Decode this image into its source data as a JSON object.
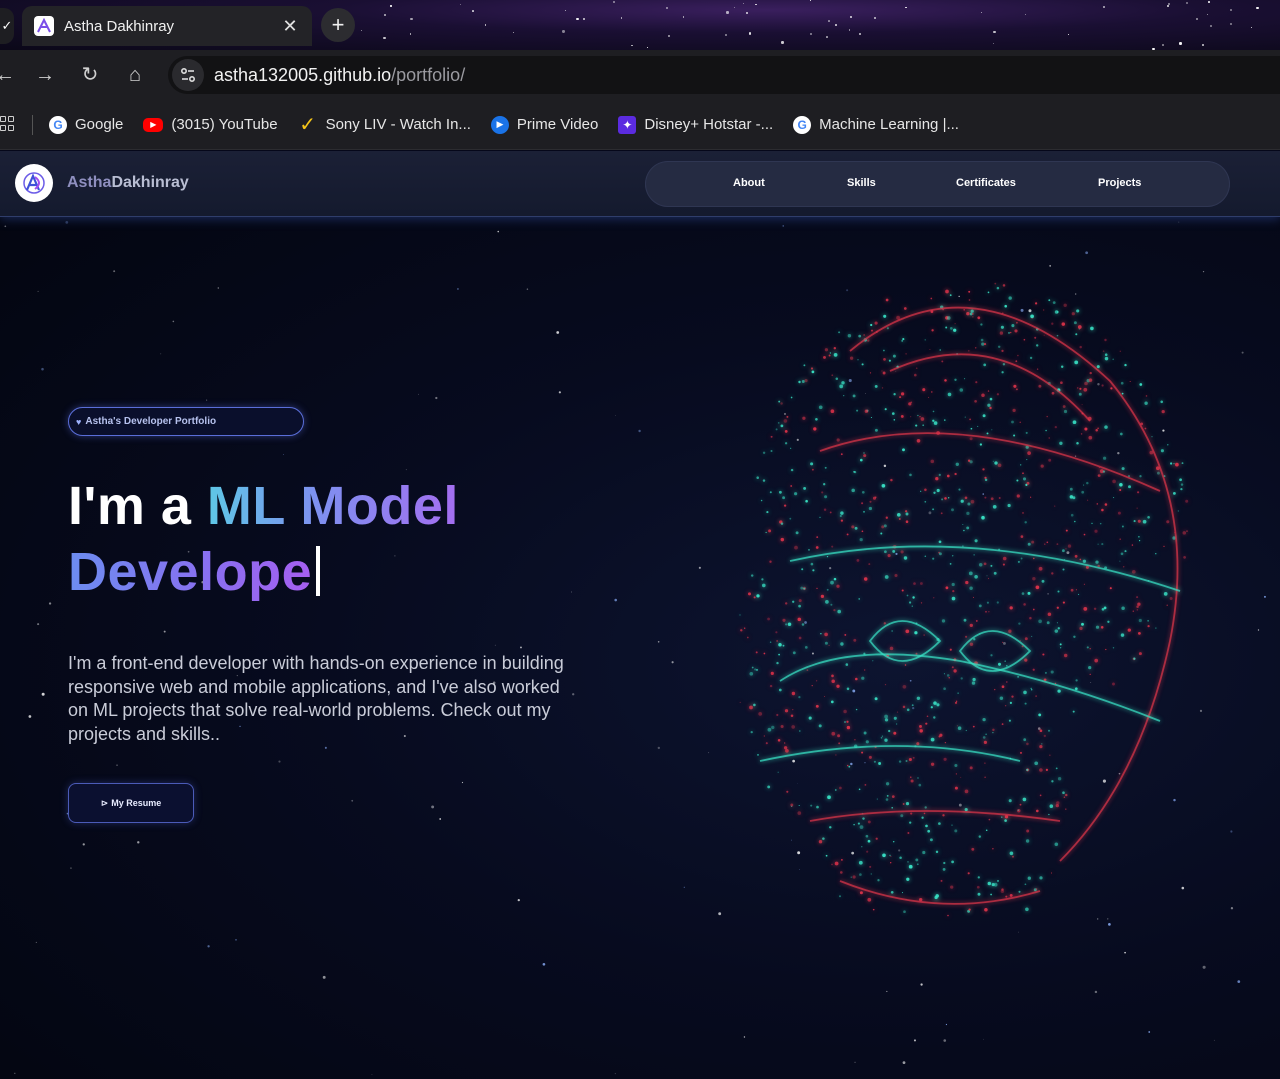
{
  "browser": {
    "tab": {
      "title": "Astha Dakhinray",
      "close_glyph": "✕",
      "favicon": "portfolio-logo-icon"
    },
    "left_tab_glyph": "✓",
    "new_tab_glyph": "+",
    "toolbar": {
      "back_glyph": "←",
      "forward_glyph": "→",
      "reload_glyph": "↻",
      "home_glyph": "⌂",
      "url_host": "astha132005.github.io",
      "url_path": "/portfolio/"
    },
    "bookmarks": [
      {
        "label": "Google",
        "icon": "google-icon",
        "glyph": "G",
        "color": "#4285f4"
      },
      {
        "label": "(3015) YouTube",
        "icon": "youtube-icon",
        "glyph": "▶",
        "color": "#ff0000"
      },
      {
        "label": "Sony LIV - Watch In...",
        "icon": "sonyliv-icon",
        "glyph": "✓",
        "color": "#f5c518"
      },
      {
        "label": "Prime Video",
        "icon": "prime-video-icon",
        "glyph": "▶",
        "color": "#1a73e8"
      },
      {
        "label": "Disney+ Hotstar -...",
        "icon": "hotstar-icon",
        "glyph": "✦",
        "color": "#5b2be0"
      },
      {
        "label": "Machine Learning  |...",
        "icon": "google-icon",
        "glyph": "G",
        "color": "#4285f4"
      }
    ]
  },
  "site": {
    "brand": {
      "first": "Astha",
      "last": "Dakhinray"
    },
    "nav": [
      "About",
      "Skills",
      "Certificates",
      "Projects"
    ],
    "badge": {
      "icon": "heart-icon",
      "glyph": "♥",
      "text": "Astha's Developer Portfolio"
    },
    "hero": {
      "prefix": "I'm a ",
      "role_line1": "ML Model",
      "role_line2": "Develope",
      "description": "I'm a front-end developer with hands-on experience in building responsive web and mobile applications, and I've also worked on ML projects that solve real-world problems. Check out my projects and skills..",
      "resume_icon": "play-icon",
      "resume_glyph": "⊳",
      "resume_label": "My Resume"
    },
    "colors": {
      "accent_blue": "#5a6ed8",
      "accent_purple": "#a46ef0",
      "accent_cyan": "#5ec7e6",
      "hologram_cyan": "#39e6c8",
      "hologram_red": "#e0334a"
    }
  }
}
